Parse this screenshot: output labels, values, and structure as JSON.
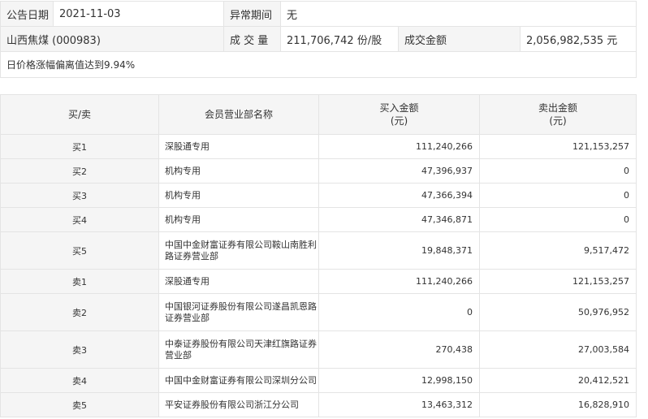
{
  "info": {
    "date_label": "公告日期",
    "date_value": "2021-11-03",
    "period_label": "异常期间",
    "period_value": "无",
    "stock_name": "山西焦煤 (000983)",
    "volume_label": "成 交 量",
    "volume_value": "211,706,742 份/股",
    "amount_label": "成交金额",
    "amount_value": "2,056,982,535 元",
    "reason": "日价格涨幅偏离值达到9.94%"
  },
  "table": {
    "headers": {
      "side": "买/卖",
      "dept": "会员营业部名称",
      "buy_line1": "买入金额",
      "buy_line2": "(元)",
      "sell_line1": "卖出金额",
      "sell_line2": "(元)"
    },
    "rows": [
      {
        "side": "买1",
        "dept": "深股通专用",
        "buy": "111,240,266",
        "sell": "121,153,257"
      },
      {
        "side": "买2",
        "dept": "机构专用",
        "buy": "47,396,937",
        "sell": "0"
      },
      {
        "side": "买3",
        "dept": "机构专用",
        "buy": "47,366,394",
        "sell": "0"
      },
      {
        "side": "买4",
        "dept": "机构专用",
        "buy": "47,346,871",
        "sell": "0"
      },
      {
        "side": "买5",
        "dept_line1": "中国中金财富证券有限公司鞍山南胜利",
        "dept_line2": "路证券营业部",
        "buy": "19,848,371",
        "sell": "9,517,472"
      },
      {
        "side": "卖1",
        "dept": "深股通专用",
        "buy": "111,240,266",
        "sell": "121,153,257"
      },
      {
        "side": "卖2",
        "dept_line1": "中国银河证券股份有限公司遂昌凯恩路",
        "dept_line2": "证券营业部",
        "buy": "0",
        "sell": "50,976,952"
      },
      {
        "side": "卖3",
        "dept_line1": "中泰证券股份有限公司天津红旗路证券",
        "dept_line2": "营业部",
        "buy": "270,438",
        "sell": "27,003,584"
      },
      {
        "side": "卖4",
        "dept": "中国中金财富证券有限公司深圳分公司",
        "buy": "12,998,150",
        "sell": "20,412,521"
      },
      {
        "side": "卖5",
        "dept": "平安证券股份有限公司浙江分公司",
        "buy": "13,463,312",
        "sell": "16,828,910"
      }
    ]
  }
}
